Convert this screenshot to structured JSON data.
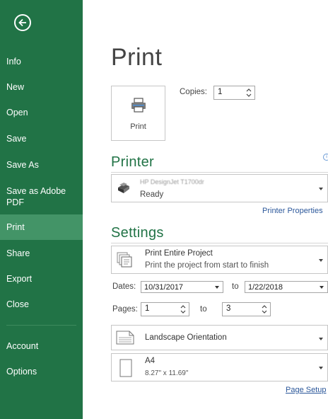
{
  "sidebar": {
    "items": [
      {
        "label": "Info"
      },
      {
        "label": "New"
      },
      {
        "label": "Open"
      },
      {
        "label": "Save"
      },
      {
        "label": "Save As"
      },
      {
        "label": "Save as Adobe PDF"
      },
      {
        "label": "Print"
      },
      {
        "label": "Share"
      },
      {
        "label": "Export"
      },
      {
        "label": "Close"
      },
      {
        "label": "Account"
      },
      {
        "label": "Options"
      }
    ],
    "active_color": "#439467",
    "bg_color": "#217346"
  },
  "page_title": "Print",
  "print_button": {
    "label": "Print"
  },
  "copies": {
    "label": "Copies:",
    "value": "1"
  },
  "printer": {
    "section_title": "Printer",
    "name": "HP DesignJet T1700dr",
    "status": "Ready",
    "properties_link": "Printer Properties"
  },
  "settings": {
    "section_title": "Settings",
    "scope": {
      "title": "Print Entire Project",
      "subtitle": "Print the project from start to finish"
    },
    "dates": {
      "label": "Dates:",
      "from": "10/31/2017",
      "to_label": "to",
      "to": "1/22/2018"
    },
    "pages": {
      "label": "Pages:",
      "from": "1",
      "to_label": "to",
      "to": "3"
    },
    "orientation": {
      "title": "Landscape Orientation"
    },
    "paper": {
      "title": "A4",
      "subtitle": "8.27\" x 11.69\""
    },
    "page_setup_link": "Page Setup"
  }
}
